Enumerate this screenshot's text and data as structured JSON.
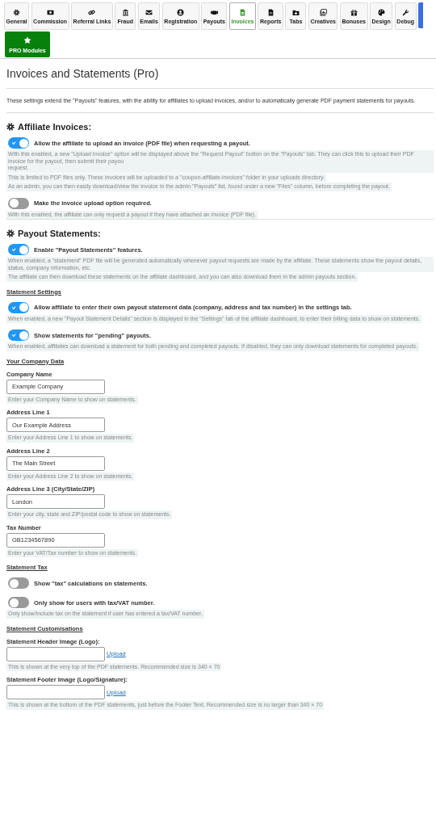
{
  "tabs": [
    {
      "label": "General",
      "selected": false
    },
    {
      "label": "Commission",
      "selected": false
    },
    {
      "label": "Referral Links",
      "selected": false
    },
    {
      "label": "Fraud",
      "selected": false
    },
    {
      "label": "Emails",
      "selected": false
    },
    {
      "label": "Registration",
      "selected": false
    },
    {
      "label": "Payouts",
      "selected": false
    },
    {
      "label": "Invoices",
      "selected": true
    },
    {
      "label": "Reports",
      "selected": false
    },
    {
      "label": "Tabs",
      "selected": false
    },
    {
      "label": "Creatives",
      "selected": false
    },
    {
      "label": "Bonuses",
      "selected": false
    },
    {
      "label": "Design",
      "selected": false
    },
    {
      "label": "Debug",
      "selected": false
    }
  ],
  "pro_button": {
    "label": "PRO Modules"
  },
  "title": "Invoices and Statements (Pro)",
  "intro": "These settings extend the \"Payouts\" features, with the ability for affiliates to upload invoices, and/or to automatically generate PDF payment statements for payouts.",
  "sections": [
    {
      "heading": "Affiliate Invoices:",
      "items": [
        {
          "kind": "toggle",
          "label": "Allow the affiliate to upload an invoice (PDF file) when requesting a payout.",
          "on": true,
          "hints": [
            "With this enabled, a new \"Upload Invoice\" option will be displayed above the \"Request Payout\" button on the \"Payouts\" tab. They can click this to upload their PDF invoice for the payout, then submit their payou\nrequest.",
            "This is limited to PDF files only. These invoices will be uploaded to a \"coupon-affiliate-invoices\" folder in your uploads directory.",
            "As an admin, you can then easily download/view the invoice in the admin \"Payouts\" list, found under a new \"Files\" column, before completing the payout."
          ]
        },
        {
          "kind": "toggle",
          "label": "Make the invoice upload option required.",
          "on": false,
          "hints": [
            "With this enabled, the affiliate can only request a payout if they have attached an invoice (PDF file)."
          ]
        }
      ]
    },
    {
      "heading": "Payout Statements:",
      "items": [
        {
          "kind": "toggle",
          "label": "Enable \"Payout Statements\" features.",
          "on": true,
          "hints": [
            "When enabled, a \"statement\" PDF file will be generated automatically whenever payout requests are made by the affiliate. These statements show the payout details, status, company information, etc.",
            "The affiliate can then download these statements on the affiliate dashboard, and you can also download them in the admin payouts section."
          ]
        },
        {
          "kind": "subheading",
          "text": "Statement Settings"
        },
        {
          "kind": "toggle",
          "label": "Allow affiliate to enter their own payout statement data (company, address and tax number) in the settings tab.",
          "on": true,
          "hints": [
            "When enabled, a new \"Payout Statement Details\" section is displayed in the \"Settings\" tab of the affiliate dashboard, to enter their billing data to show on statements."
          ]
        },
        {
          "kind": "toggle",
          "label": "Show statements for \"pending\" payouts.",
          "on": true,
          "hints": [
            "When enabled, affiliates can download a statement for both pending and completed payouts. If disabled, they can only download statements for completed payouts."
          ]
        },
        {
          "kind": "subheading",
          "text": "Your Company Data"
        },
        {
          "kind": "field",
          "label": "Company Name",
          "value": "Example Company",
          "hint": "Enter your Company Name to show on statements."
        },
        {
          "kind": "field",
          "label": "Address Line 1",
          "value": "Our Example Address",
          "hint": "Enter your Address Line 1 to show on statements."
        },
        {
          "kind": "field",
          "label": "Address Line 2",
          "value": "The Main Street",
          "hint": "Enter your Address Line 2 to show on statements."
        },
        {
          "kind": "field",
          "label": "Address Line 3 (City/State/ZIP)",
          "value": "London",
          "hint": "Enter your city, state and ZIP/postal code to show on statements."
        },
        {
          "kind": "field",
          "label": "Tax Number",
          "value": "GB1234567890",
          "hint": "Enter your VAT/Tax number to show on statements."
        },
        {
          "kind": "subheading",
          "text": "Statement Tax"
        },
        {
          "kind": "toggle",
          "label": "Show \"tax\" calculations on statements.",
          "on": false
        },
        {
          "kind": "toggle",
          "label": "Only show for users with tax/VAT number.",
          "on": false,
          "hints": [
            "Only show/include tax on the statement if user has entered a tax/VAT number."
          ]
        },
        {
          "kind": "subheading",
          "text": "Statement Customisations"
        },
        {
          "kind": "upload",
          "label": "Statement Header Image (Logo):",
          "link": "Upload",
          "hint": "This is shown at the very top of the PDF statements. Recommended size is 340 × 70"
        },
        {
          "kind": "upload",
          "label": "Statement Footer Image (Logo/Signature):",
          "link": "Upload",
          "hint": "This is shown at the bottom of the PDF statements, just before the Footer Text. Recommended size is no larger than 340 × 70"
        }
      ]
    }
  ]
}
